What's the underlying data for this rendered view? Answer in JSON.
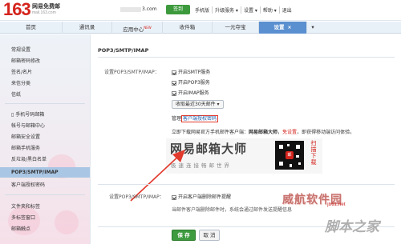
{
  "header": {
    "logo_number": "163",
    "logo_name": "网易免费邮",
    "logo_domain": "mail.163.com",
    "account_suffix": "3.com",
    "sign_in_label": "签到",
    "links": [
      "手机版",
      "升级服务 ▾",
      "设置 ▾",
      "帮助 ▾",
      "退出"
    ]
  },
  "tabs": [
    {
      "label": "首页"
    },
    {
      "label": "通讯录"
    },
    {
      "label": "应用中心",
      "badge": "NEW"
    },
    {
      "label": "收件箱"
    },
    {
      "label": "一元夺宝"
    },
    {
      "label": "设置",
      "close": "×"
    }
  ],
  "tab_pin": "▾",
  "sidebar": {
    "group1": [
      "常规设置",
      "邮箱密码修改",
      "签名/名片",
      "来信分类",
      "信纸"
    ],
    "group2": [
      "手机号码邮箱",
      "帐号与邮箱中心",
      "邮箱安全设置",
      "邮箱手机服务",
      "反垃圾/黑白名单"
    ],
    "active": "POP3/SMTP/IMAP",
    "group3": [
      "客户端授权密码"
    ],
    "group4": [
      "文件夹和标签",
      "多标签窗口",
      "邮箱触点"
    ]
  },
  "main": {
    "section_title": "POP3/SMTP/IMAP",
    "label_service": "设置POP3/SMTP/IMAP：",
    "checks": [
      "开启SMTP服务",
      "开启POP3服务",
      "开启IMAP服务"
    ],
    "dropdown": "收取最近30天邮件 ▾",
    "manage_prefix": "管理",
    "manage_link": "客户端授权密码",
    "desc_prefix": "立即下载网易官方手机邮件客户端：",
    "desc_app": "网易邮箱大师",
    "desc_sep": "，",
    "desc_free": "免设置",
    "desc_suffix": "，即获得移动端访问体验。",
    "promo_title": "网易邮箱大师",
    "promo_sub": "极速连接畅邮世界",
    "qr_badge": "邮",
    "scan_text": "扫描下载",
    "label_service2": "设置POP3/SMTP/IMAP：",
    "check_delete": "开启客户端删除邮件提醒",
    "note": "当邮件客户端删除邮件时，系统会通过邮件发送提醒信息",
    "save_label": "保 存",
    "cancel_label": "取 消"
  },
  "watermark": {
    "cn": "威航软件园",
    "site": "jb51.net",
    "script": "脚本之家"
  },
  "colors": {
    "brand_red": "#d4231c",
    "active_tab": "#5a8fd0",
    "save_green": "#3f9b3f",
    "arrow_red": "#e23a2d"
  }
}
